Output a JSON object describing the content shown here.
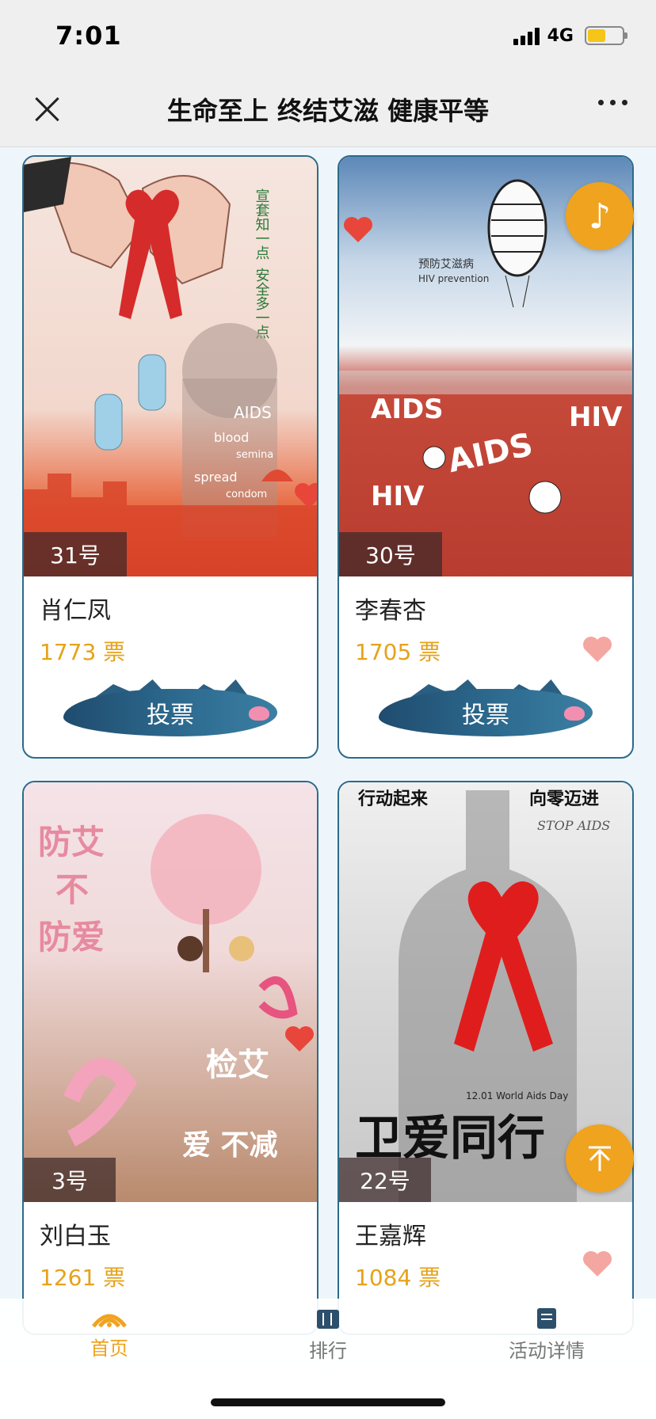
{
  "status": {
    "time": "7:01",
    "network": "4G"
  },
  "nav": {
    "title": "生命至上 终结艾滋 健康平等"
  },
  "cards": [
    {
      "number": "31号",
      "name": "肖仁凤",
      "votes": "1773 票",
      "vote_label": "投票"
    },
    {
      "number": "30号",
      "name": "李春杏",
      "votes": "1705 票",
      "vote_label": "投票"
    },
    {
      "number": "3号",
      "name": "刘白玉",
      "votes": "1261 票"
    },
    {
      "number": "22号",
      "name": "王嘉辉",
      "votes": "1084 票"
    }
  ],
  "poster_text": {
    "p1_side": "宣套知一点 安全多一点",
    "p1_words": [
      "AIDS",
      "blood",
      "semina",
      "spread",
      "condom"
    ],
    "p2_title": "预防艾滋病",
    "p2_sub": "HIV prevention",
    "p2_words": [
      "AIDS",
      "HIV",
      "HIV",
      "AIDS"
    ],
    "p3_title": "防艾不防爱",
    "p3_sub": "检艾",
    "p3_sub2": "爱 不减",
    "p4_left": "行动起来",
    "p4_right": "向零迈进",
    "p4_stop": "STOP AIDS",
    "p4_date": "12.01 World Aids Day",
    "p4_big": "卫爱同行"
  },
  "tabs": [
    {
      "label": "首页",
      "active": true
    },
    {
      "label": "排行"
    },
    {
      "label": "活动详情"
    }
  ],
  "icons": {
    "music": "music-note-icon",
    "top": "back-to-top-icon"
  },
  "colors": {
    "accent": "#f0a31e",
    "border": "#2c6b8a",
    "votes": "#e6a21a"
  }
}
